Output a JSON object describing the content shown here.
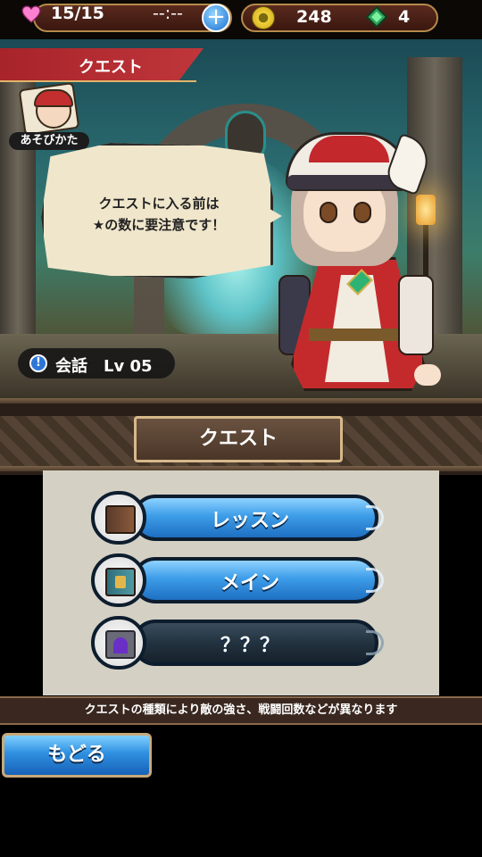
{
  "status": {
    "stamina": "15/15",
    "stamina_timer": "--:--",
    "plus_label": "+",
    "coins": "248",
    "gems": "4"
  },
  "scene": {
    "title": "クエスト",
    "howto_label": "あそびかた",
    "dialogue_line1": "クエストに入る前は",
    "dialogue_line2": "★の数に要注意です！",
    "talk_info": "!",
    "talk_label": "会話　Lv 05"
  },
  "section_title": "クエスト",
  "menu": {
    "items": [
      {
        "label": "レッスン",
        "icon": "lesson-book-icon"
      },
      {
        "label": "メイン",
        "icon": "main-book-icon"
      },
      {
        "label": "？？？",
        "icon": "locked-gate-icon"
      }
    ]
  },
  "info_text": "クエストの種類により敵の強さ、戦闘回数などが異なります",
  "back_label": "もどる",
  "colors": {
    "accent_red": "#c0363a",
    "button_blue": "#3d9de8",
    "locked_dark": "#22323f"
  }
}
